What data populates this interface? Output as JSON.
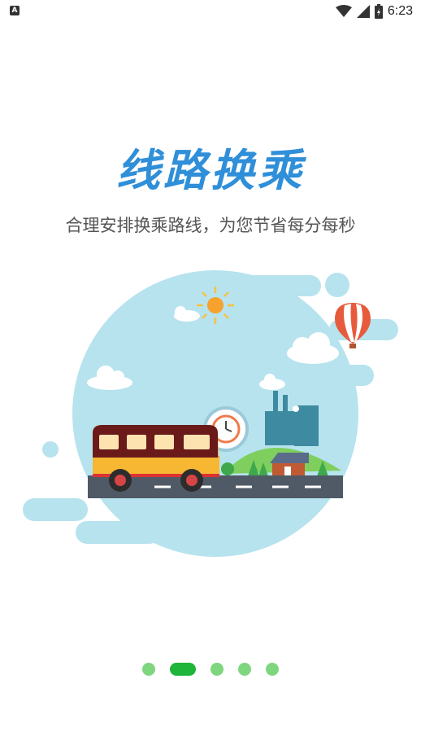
{
  "status_bar": {
    "time": "6:23",
    "left_icon": "A",
    "icons": [
      "wifi-icon",
      "signal-icon",
      "battery-icon"
    ]
  },
  "page": {
    "title": "线路换乘",
    "subtitle": "合理安排换乘路线，为您节省每分每秒"
  },
  "pager": {
    "total_pages": 5,
    "active_index": 1
  },
  "colors": {
    "title": "#2f8fd8",
    "sky": "#b6e3ee",
    "bus_yellow": "#f7b733",
    "bus_roof": "#6b1a1a",
    "dot_inactive": "#7ed67e",
    "dot_active": "#1fb53a"
  }
}
